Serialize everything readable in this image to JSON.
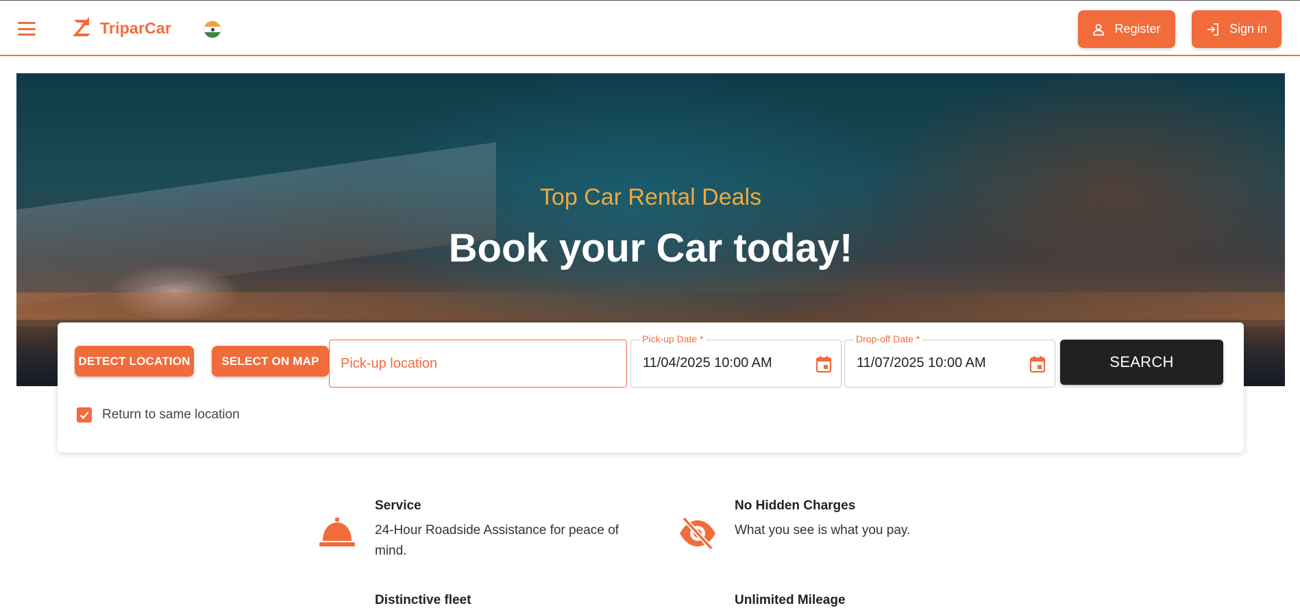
{
  "header": {
    "brand": "TriparCar",
    "register_label": "Register",
    "signin_label": "Sign in"
  },
  "hero": {
    "subtitle": "Top Car Rental Deals",
    "title": "Book your Car today!"
  },
  "search": {
    "detect_label": "DETECT LOCATION",
    "map_label": "SELECT ON MAP",
    "pickup_placeholder": "Pick-up location",
    "pickup_date_label": "Pick-up Date *",
    "pickup_date_value": "11/04/2025 10:00 AM",
    "dropoff_date_label": "Drop-off Date *",
    "dropoff_date_value": "11/07/2025 10:00 AM",
    "search_label": "SEARCH",
    "return_label": "Return to same location",
    "return_checked": true
  },
  "features": [
    {
      "title": "Service",
      "desc": "24-Hour Roadside Assistance for peace of mind.",
      "icon": "service-bell-icon"
    },
    {
      "title": "No Hidden Charges",
      "desc": "What you see is what you pay.",
      "icon": "eye-off-icon"
    },
    {
      "title": "Distinctive fleet",
      "desc": "",
      "icon": ""
    },
    {
      "title": "Unlimited Mileage",
      "desc": "",
      "icon": ""
    }
  ],
  "colors": {
    "accent": "#f26b3a",
    "hero_subtitle": "#f2a93b",
    "search_button": "#212121"
  }
}
